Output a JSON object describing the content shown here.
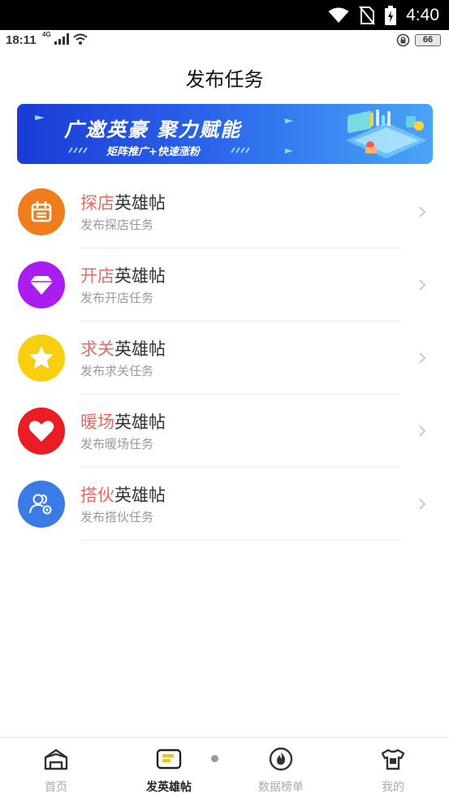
{
  "system_bar": {
    "time": "4:40"
  },
  "app_status": {
    "time": "18:11",
    "network": "4G",
    "battery": "66"
  },
  "page": {
    "title": "发布任务"
  },
  "banner": {
    "headline": "广邀英豪 聚力赋能",
    "subline": "矩阵推广+快速涨粉"
  },
  "tasks": [
    {
      "highlight": "探店",
      "rest": "英雄帖",
      "desc": "发布探店任务",
      "icon": "calendar-icon",
      "color": "#f07d1b"
    },
    {
      "highlight": "开店",
      "rest": "英雄帖",
      "desc": "发布开店任务",
      "icon": "diamond-icon",
      "color": "#a91df0"
    },
    {
      "highlight": "求关",
      "rest": "英雄帖",
      "desc": "发布求关任务",
      "icon": "star-icon",
      "color": "#f7cf10"
    },
    {
      "highlight": "暖场",
      "rest": "英雄帖",
      "desc": "发布暖场任务",
      "icon": "heart-icon",
      "color": "#eb1c24"
    },
    {
      "highlight": "搭伙",
      "rest": "英雄帖",
      "desc": "发布搭伙任务",
      "icon": "users-gear-icon",
      "color": "#3a7be6"
    }
  ],
  "bottom_nav": [
    {
      "label": "首页",
      "icon": "home-icon",
      "active": false
    },
    {
      "label": "发英雄帖",
      "icon": "post-icon",
      "active": true
    },
    {
      "label": "数据榜单",
      "icon": "fire-icon",
      "active": false
    },
    {
      "label": "我的",
      "icon": "shirt-icon",
      "active": false
    }
  ],
  "colors": {
    "highlight": "#e9695f",
    "accent": "#f7c500"
  }
}
